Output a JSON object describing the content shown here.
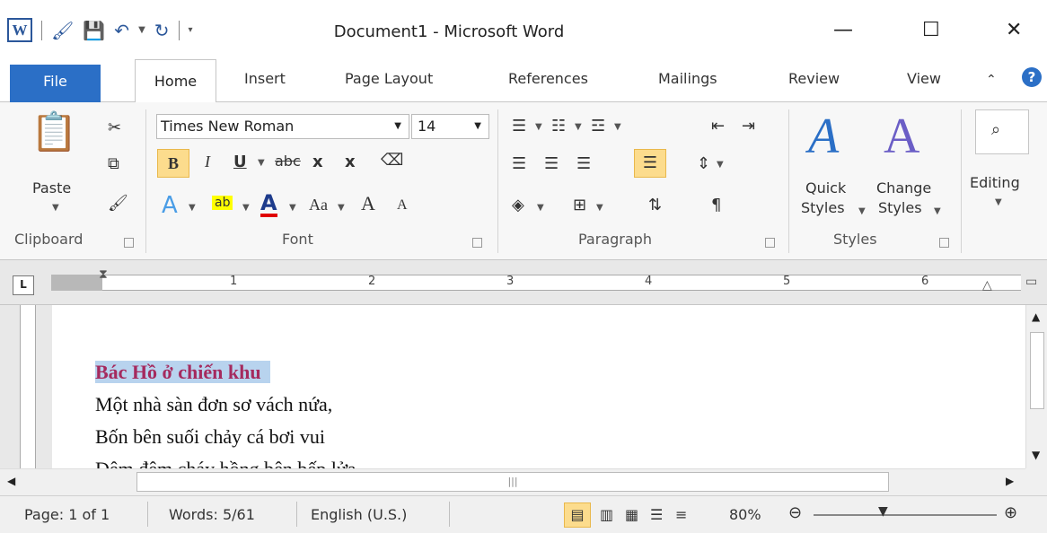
{
  "window": {
    "title": "Document1 - Microsoft Word"
  },
  "tabs": [
    "File",
    "Home",
    "Insert",
    "Page Layout",
    "References",
    "Mailings",
    "Review",
    "View"
  ],
  "clipboard": {
    "paste_label": "Paste",
    "group_label": "Clipboard"
  },
  "font": {
    "name": "Times New Roman",
    "size": "14",
    "group_label": "Font",
    "bold": "B",
    "italic": "I",
    "underline": "U",
    "strike": "abc",
    "sub": "x",
    "sup": "x",
    "case": "Aa",
    "grow": "A",
    "shrink": "A"
  },
  "paragraph": {
    "group_label": "Paragraph",
    "pilcrow": "¶"
  },
  "styles": {
    "quick_label_1": "Quick",
    "quick_label_2": "Styles",
    "change_label_1": "Change",
    "change_label_2": "Styles",
    "group_label": "Styles"
  },
  "editing": {
    "label": "Editing"
  },
  "ruler": {
    "numbers": [
      "1",
      "2",
      "3",
      "4",
      "5",
      "6"
    ],
    "tab_selector": "L"
  },
  "document": {
    "lines": [
      "Bác Hồ ở chiến khu",
      "Một nhà sàn đơn sơ vách nứa,",
      "Bốn bên suối chảy cá bơi vui",
      "Đêm đêm cháy hồng bên bếp lửa"
    ]
  },
  "status": {
    "page": "Page: 1 of 1",
    "words": "Words: 5/61",
    "language": "English (U.S.)",
    "zoom": "80%"
  },
  "colors": {
    "file_tab": "#2b6fc6",
    "title_text": "#a52a5e",
    "selection": "#b8d3ee",
    "active_button": "#fcdc8d"
  }
}
